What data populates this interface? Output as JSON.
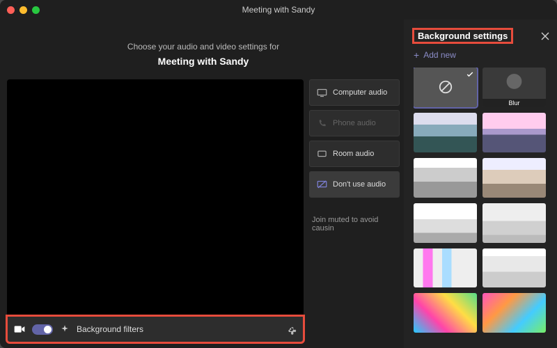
{
  "titlebar": {
    "title": "Meeting with Sandy"
  },
  "main": {
    "prompt": "Choose your audio and video settings for",
    "meeting_name": "Meeting with Sandy",
    "bg_filters_label": "Background filters",
    "audio_opts": {
      "computer": "Computer audio",
      "phone": "Phone audio",
      "room": "Room audio",
      "none": "Don't use audio"
    },
    "mute_msg": "Join muted to avoid causin"
  },
  "panel": {
    "title": "Background settings",
    "add_new": "Add new",
    "blur_label": "Blur"
  },
  "chart_data": null
}
